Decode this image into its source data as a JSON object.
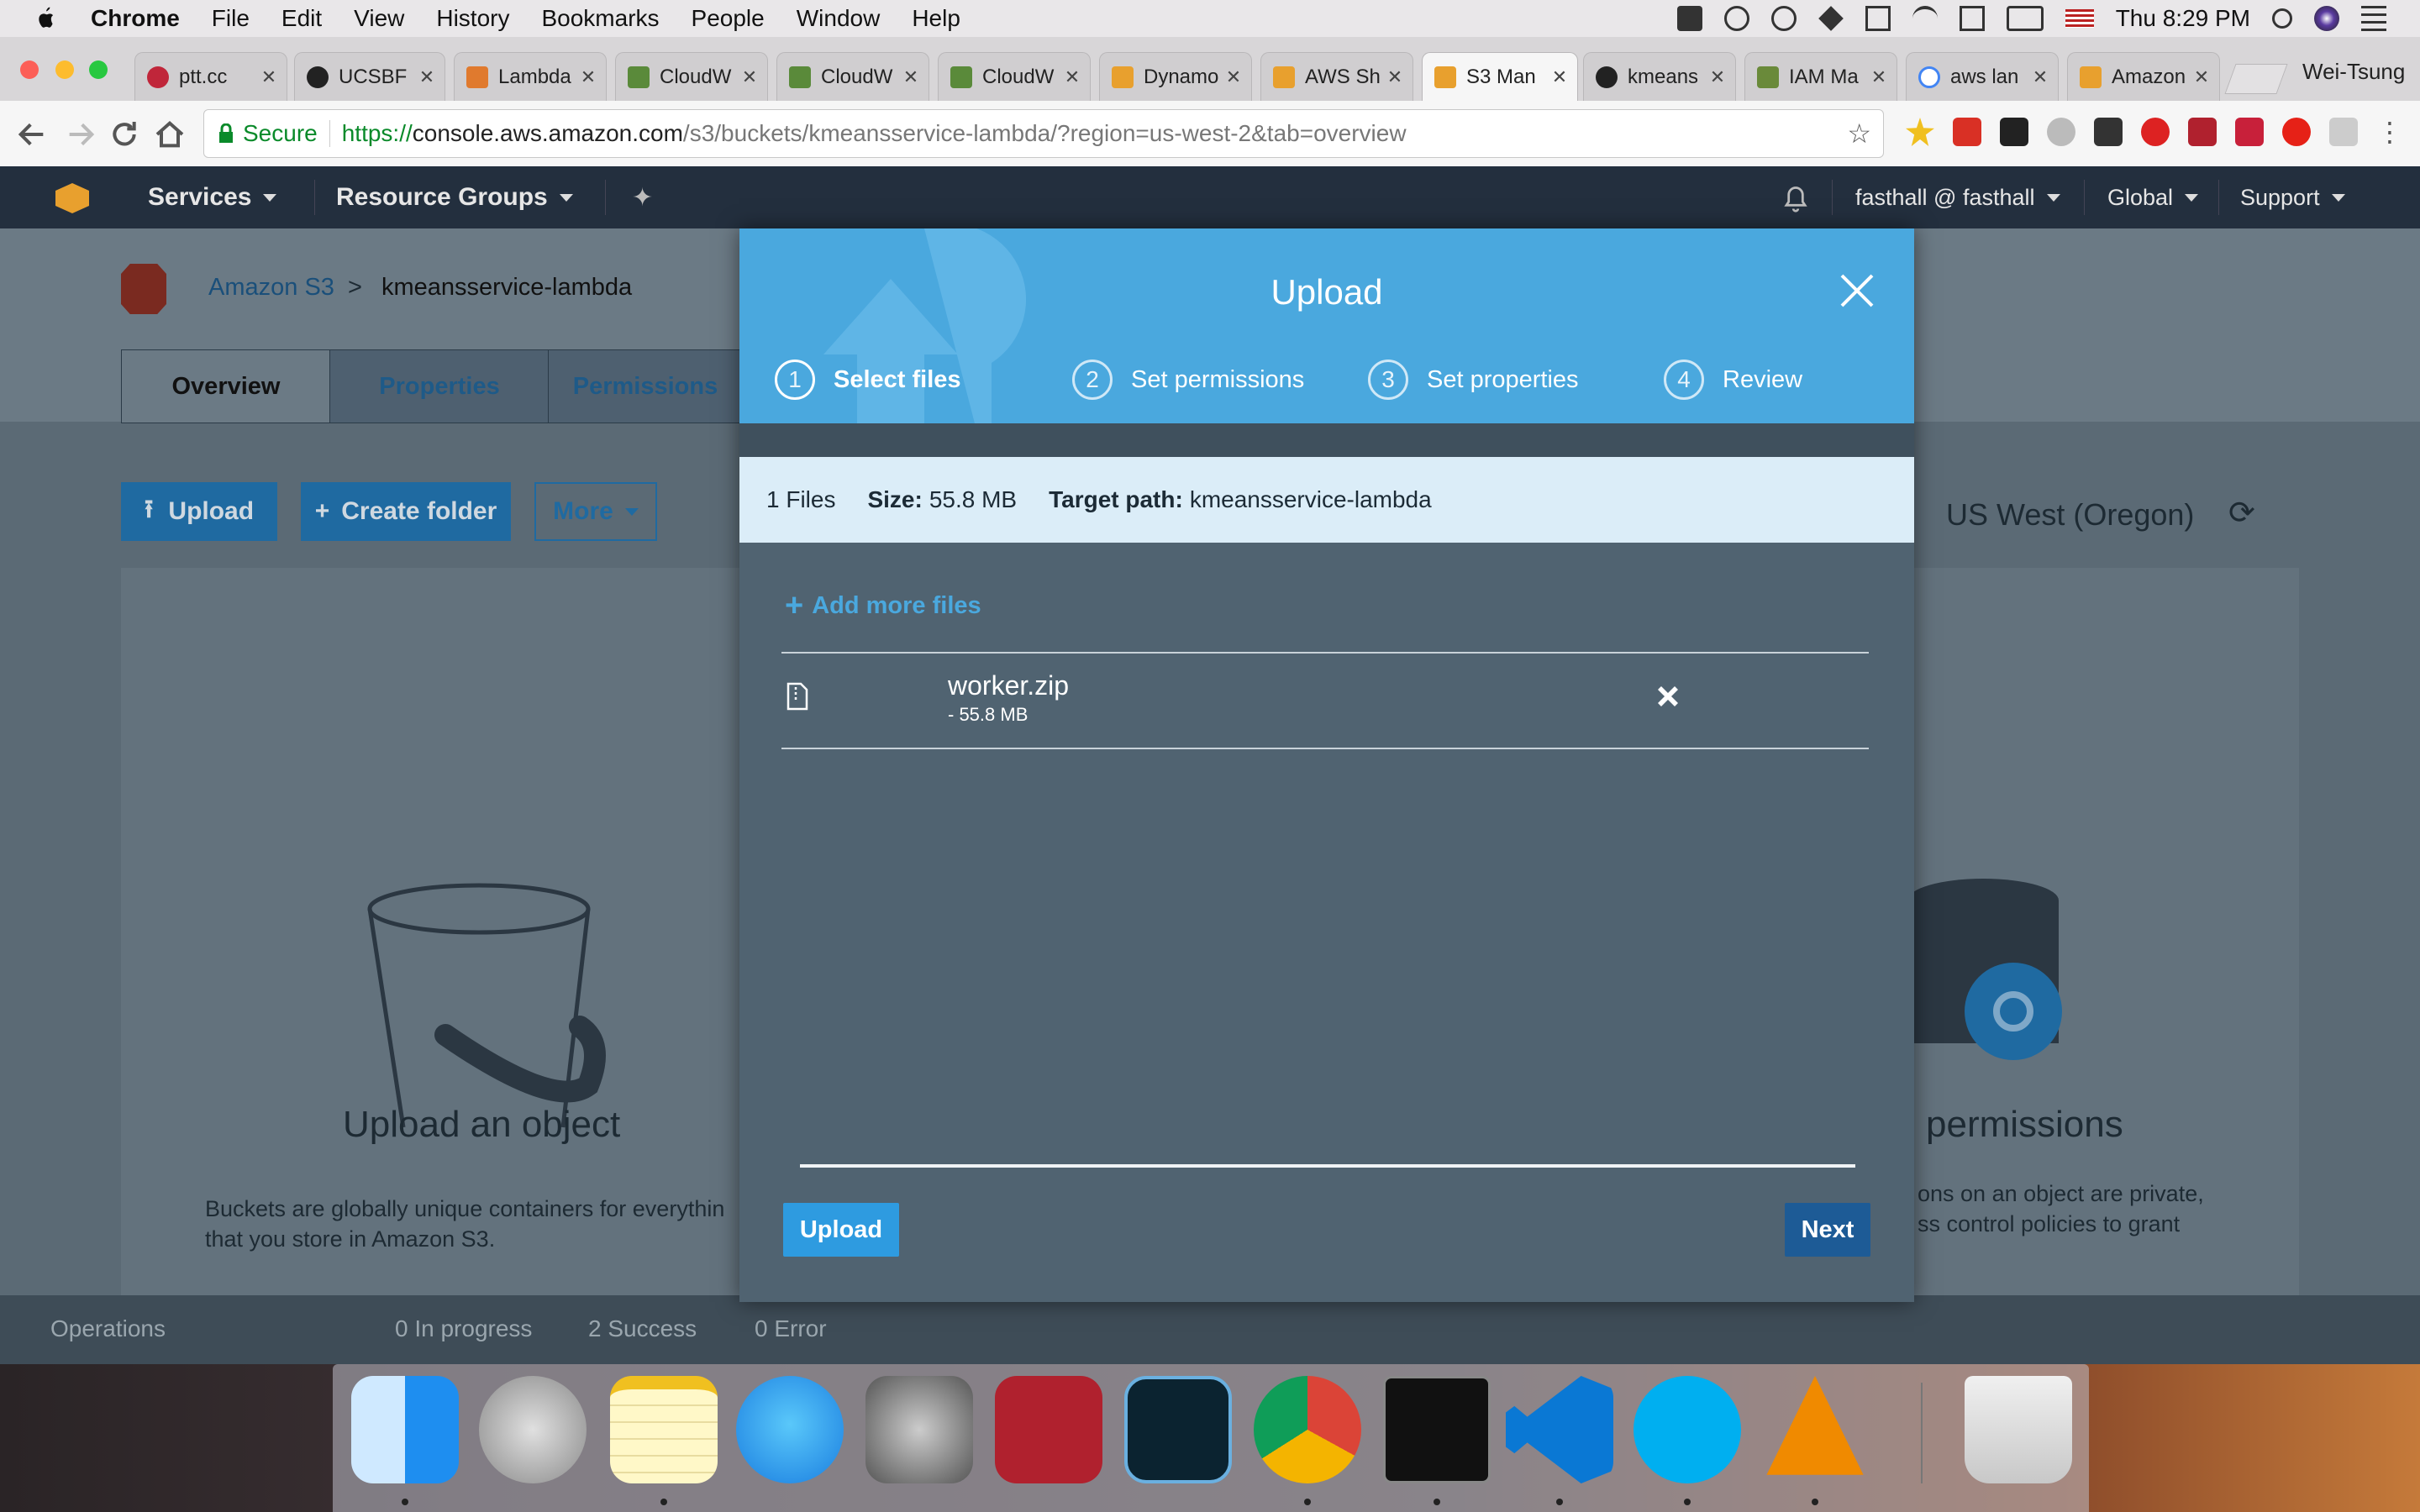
{
  "menubar": {
    "app_name": "Chrome",
    "menus": [
      "File",
      "Edit",
      "View",
      "History",
      "Bookmarks",
      "People",
      "Window",
      "Help"
    ],
    "clock": "Thu 8:29 PM",
    "user": "Wei-Tsung"
  },
  "tabs": [
    {
      "label": "ptt.cc",
      "color": "#c0263a"
    },
    {
      "label": "UCSBF",
      "color": "#222"
    },
    {
      "label": "Lambda",
      "color": "#e07a2e"
    },
    {
      "label": "CloudW",
      "color": "#5a8a3a"
    },
    {
      "label": "CloudW",
      "color": "#5a8a3a"
    },
    {
      "label": "CloudW",
      "color": "#5a8a3a"
    },
    {
      "label": "Dynamo",
      "color": "#e8a02e"
    },
    {
      "label": "AWS Sh",
      "color": "#e8a02e"
    },
    {
      "label": "S3 Man",
      "color": "#e8a02e",
      "active": true
    },
    {
      "label": "kmeans",
      "color": "#222"
    },
    {
      "label": "IAM Ma",
      "color": "#6a8a3a"
    },
    {
      "label": "aws lan",
      "color": "#4285f4"
    },
    {
      "label": "Amazon",
      "color": "#e8a02e"
    }
  ],
  "address": {
    "secure_label": "Secure",
    "url_scheme": "https://",
    "url_host": "console.aws.amazon.com",
    "url_path": "/s3/buckets/kmeansservice-lambda/?region=us-west-2&tab=overview"
  },
  "aws_header": {
    "services": "Services",
    "resource_groups": "Resource Groups",
    "account": "fasthall @ fasthall",
    "region": "Global",
    "support": "Support"
  },
  "page": {
    "breadcrumb_root": "Amazon S3",
    "breadcrumb_sep": ">",
    "breadcrumb_bucket": "kmeansservice-lambda",
    "tabs": [
      "Overview",
      "Properties",
      "Permissions"
    ],
    "upload_btn": "Upload",
    "create_folder_btn": "Create folder",
    "more_btn": "More",
    "region_label": "US West (Oregon)",
    "card_left_title": "Upload an object",
    "card_left_text_1": "Buckets are globally unique containers for everythin",
    "card_left_text_2": "that you store in Amazon S3.",
    "card_right_title": "permissions",
    "card_right_text_1": "ons on an object are private,",
    "card_right_text_2": "ss control policies to grant"
  },
  "operations": {
    "label": "Operations",
    "in_progress": "0 In progress",
    "success": "2 Success",
    "error": "0 Error"
  },
  "modal": {
    "title": "Upload",
    "steps": [
      {
        "num": "1",
        "label": "Select files",
        "active": true
      },
      {
        "num": "2",
        "label": "Set permissions"
      },
      {
        "num": "3",
        "label": "Set properties"
      },
      {
        "num": "4",
        "label": "Review"
      }
    ],
    "info_files": "1 Files",
    "info_size_label": "Size:",
    "info_size_value": "55.8 MB",
    "info_target_label": "Target path:",
    "info_target_value": "kmeansservice-lambda",
    "add_more": "Add more files",
    "file_name": "worker.zip",
    "file_size": "- 55.8 MB",
    "upload_button": "Upload",
    "next_button": "Next"
  },
  "dock": [
    "Finder",
    "Launchpad",
    "Notes",
    "Messages",
    "System Preferences",
    "Mendeley",
    "Lightroom",
    "Chrome",
    "Terminal",
    "VS Code",
    "Skype",
    "VLC",
    "Trash"
  ]
}
